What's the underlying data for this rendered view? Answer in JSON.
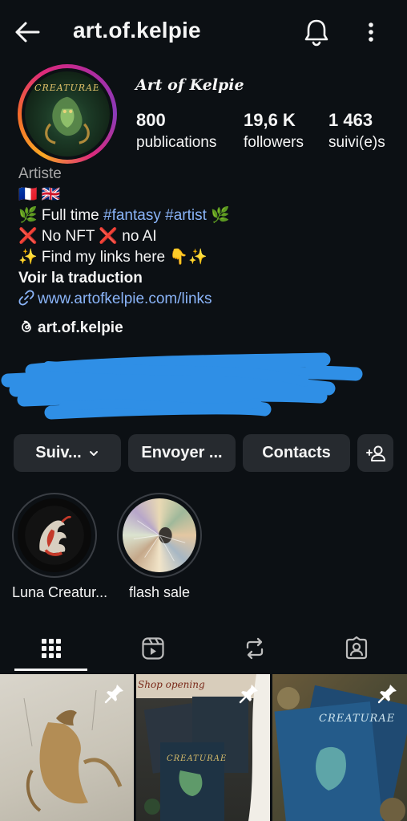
{
  "header": {
    "username": "art.of.kelpie",
    "icons": [
      "back-arrow-icon",
      "bell-icon",
      "more-vertical-icon"
    ]
  },
  "profile": {
    "display_name": "Art of Kelpie",
    "avatar_text": "CREATURAE",
    "stats": [
      {
        "value": "800",
        "label": "publications"
      },
      {
        "value": "19,6 K",
        "label": "followers"
      },
      {
        "value": "1 463",
        "label": "suivi(e)s"
      }
    ]
  },
  "bio": {
    "category": "Artiste",
    "flags": "🇫🇷 🇬🇧",
    "line1_prefix": "🌿 Full time ",
    "line1_tag1": "#fantasy",
    "line1_space": " ",
    "line1_tag2": "#artist",
    "line1_suffix": " 🌿",
    "line2": "❌ No NFT ❌ no AI",
    "line3": "✨ Find my links here 👇✨",
    "translate": "Voir la traduction",
    "link": "www.artofkelpie.com/links",
    "threads": "art.of.kelpie"
  },
  "actions": {
    "follow": "Suiv...",
    "message": "Envoyer ...",
    "contacts": "Contacts"
  },
  "highlights": [
    {
      "label": "Luna Creatur..."
    },
    {
      "label": "flash sale"
    }
  ],
  "tabs": [
    "grid-icon",
    "reels-icon",
    "reposts-icon",
    "tagged-icon"
  ],
  "posts": [
    {
      "pinned": true,
      "caption": ""
    },
    {
      "pinned": true,
      "caption": "Shop opening",
      "book_title": "CREATURAE"
    },
    {
      "pinned": true,
      "caption": "",
      "book_title": "CREATURAE"
    }
  ],
  "colors": {
    "background": "#0c1014",
    "button": "#262a2f",
    "link": "#8ab4f8",
    "scribble": "#2f8fe6"
  }
}
